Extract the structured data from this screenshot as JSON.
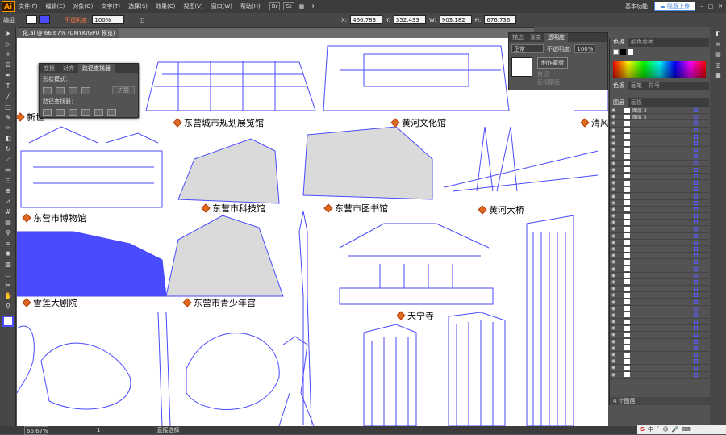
{
  "app": {
    "logo": "Ai"
  },
  "menu": [
    "文件(F)",
    "编辑(E)",
    "对象(O)",
    "文字(T)",
    "选择(S)",
    "效果(C)",
    "视图(V)",
    "窗口(W)",
    "帮助(H)"
  ],
  "workspace": "基本功能",
  "cloud_label": "隐瓶上传",
  "control": {
    "group_label": "编组",
    "opacity_label": "不透明度:",
    "opacity_value": "100%",
    "x_value": "466.783",
    "y_value": "352.433",
    "w_value": "903.182",
    "h_value": "676.736"
  },
  "document_tab": "化.ai @ 66.67% (CMYK/GPU 预览)",
  "pathfinder": {
    "tabs": [
      "变换",
      "对齐",
      "路径查找器"
    ],
    "shape_modes": "形状模式：",
    "finders": "路径查找器：",
    "expand": "扩展"
  },
  "transparency": {
    "tabs": [
      "描边",
      "渐变",
      "透明度"
    ],
    "mode": "正常",
    "opacity_label": "不透明度:",
    "opacity_value": "100%",
    "make_mask": "制作蒙版",
    "clip": "剪切",
    "invert": "反相蒙版"
  },
  "swatches": {
    "tabs": [
      "色板",
      "颜色参考"
    ],
    "tabs2": [
      "色板",
      "画笔",
      "符号"
    ]
  },
  "layers": {
    "tabs": [
      "图层",
      "画板"
    ],
    "items": [
      "图层 3",
      "图层 5",
      "",
      "",
      "",
      "",
      "",
      "",
      "",
      "",
      "",
      "",
      "",
      "",
      "",
      "",
      "",
      "",
      "",
      "",
      "",
      "",
      "",
      "",
      "",
      "",
      "",
      "",
      "",
      "",
      "",
      "",
      "",
      "",
      "",
      "",
      "",
      "",
      "",
      "",
      ""
    ],
    "count": "4 个图层"
  },
  "labels": [
    {
      "text": "东营城市规划展览馆"
    },
    {
      "text": "黄河文化馆"
    },
    {
      "text": "清风"
    },
    {
      "text": "新世"
    },
    {
      "text": "东营市博物馆"
    },
    {
      "text": "东营市科技馆"
    },
    {
      "text": "东营市图书馆"
    },
    {
      "text": "黄河大桥"
    },
    {
      "text": "雪莲大剧院"
    },
    {
      "text": "东营市青少年宫"
    },
    {
      "text": "天宁寺"
    }
  ],
  "status": {
    "zoom": "66.67%",
    "page": "1",
    "tool": "直接选择"
  },
  "colors": {
    "accent": "#4a4aff",
    "bg": "#535353",
    "label_icon": "#e06a20"
  },
  "icons": [
    "selection-icon",
    "direct-selection-icon",
    "magic-wand-icon",
    "lasso-icon",
    "pen-icon",
    "type-icon",
    "line-icon",
    "rectangle-icon",
    "brush-icon",
    "pencil-icon",
    "eraser-icon",
    "rotate-icon",
    "scale-icon",
    "width-icon",
    "free-transform-icon",
    "shape-builder-icon",
    "perspective-icon",
    "mesh-icon",
    "gradient-icon",
    "eyedropper-icon",
    "blend-icon",
    "symbol-sprayer-icon",
    "graph-icon",
    "artboard-icon",
    "slice-icon",
    "hand-icon",
    "zoom-icon"
  ]
}
